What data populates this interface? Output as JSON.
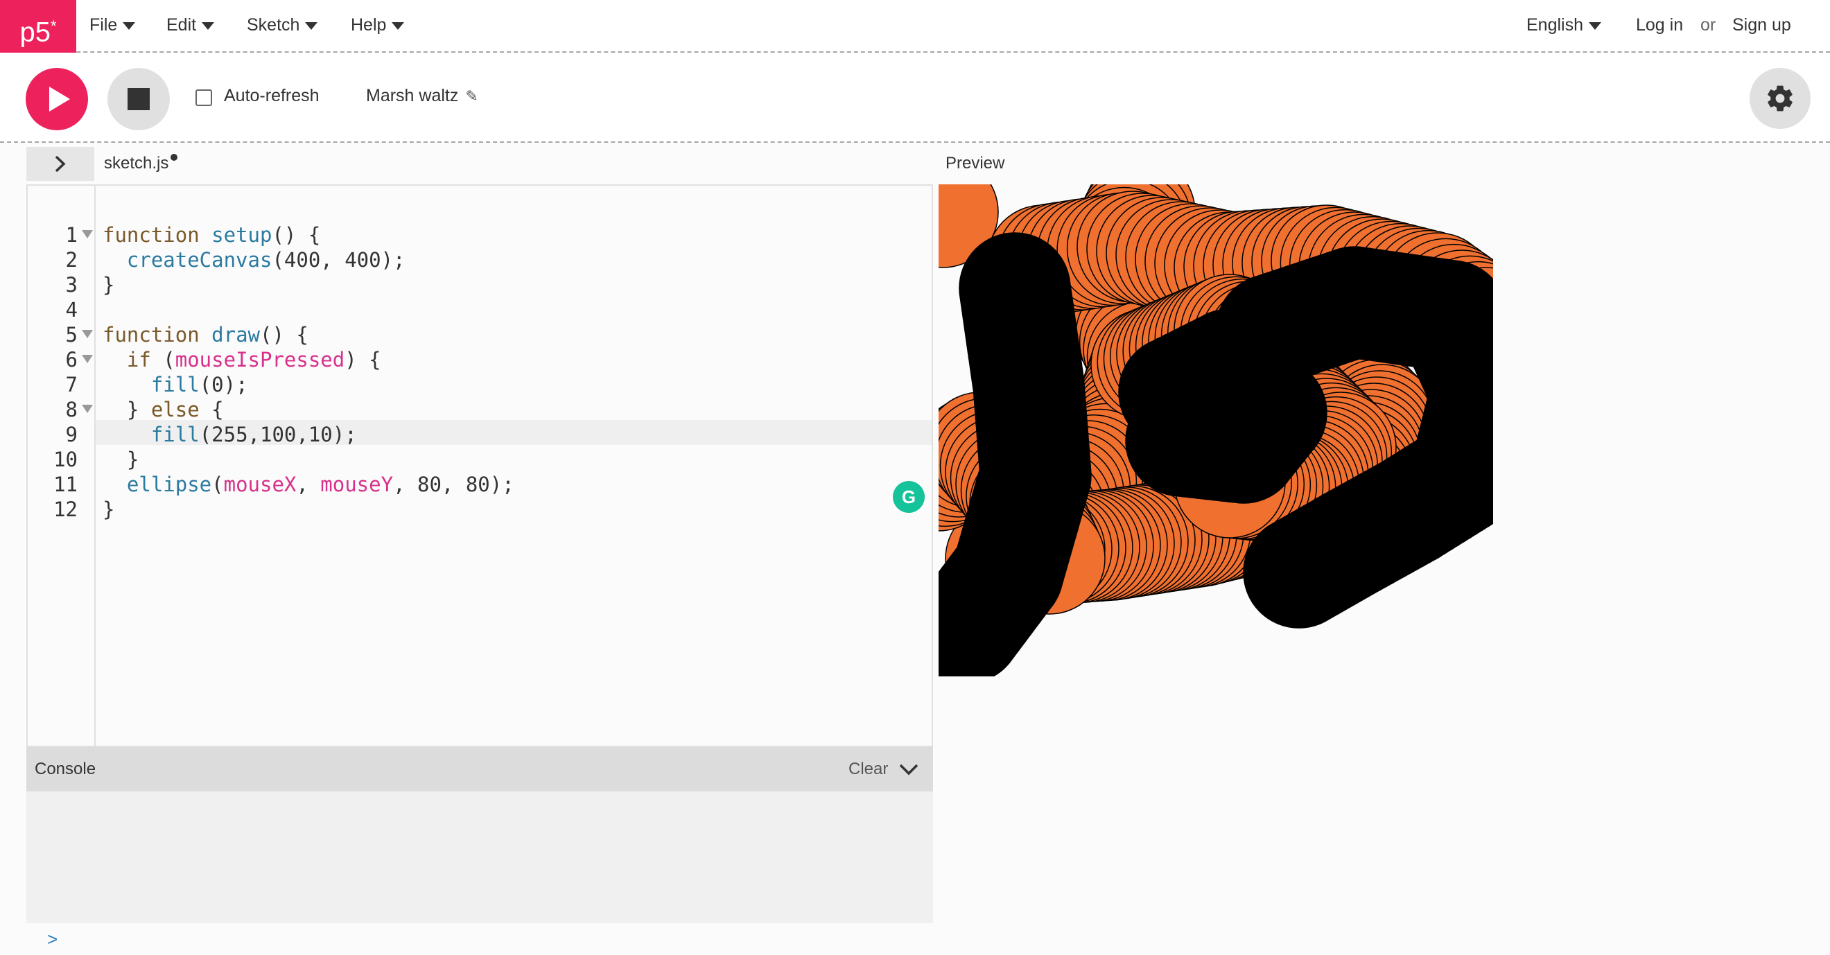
{
  "nav": {
    "logo": "p5",
    "logo_sup": "*",
    "menu": [
      {
        "label": "File"
      },
      {
        "label": "Edit"
      },
      {
        "label": "Sketch"
      },
      {
        "label": "Help"
      }
    ],
    "language": "English",
    "login": "Log in",
    "or": "or",
    "signup": "Sign up"
  },
  "toolbar": {
    "autorefresh_label": "Auto-refresh",
    "autorefresh_checked": false,
    "sketch_name": "Marsh waltz"
  },
  "editor": {
    "tab_name": "sketch.js",
    "active_line": 9,
    "line_numbers": [
      "1",
      "2",
      "3",
      "4",
      "5",
      "6",
      "7",
      "8",
      "9",
      "10",
      "11",
      "12"
    ],
    "folds": [
      1,
      5,
      6,
      8
    ]
  },
  "preview": {
    "label": "Preview",
    "fill_color": "#f07030",
    "stroke_color": "#000000"
  },
  "console": {
    "title": "Console",
    "clear_label": "Clear",
    "prompt": ">"
  },
  "colors": {
    "brand": "#ed225d",
    "keyword": "#7a5a2a",
    "function": "#2b7aa0",
    "variable": "#d9308b"
  },
  "icons": [
    "play-icon",
    "stop-icon",
    "pencil-icon",
    "gear-icon",
    "chevron-right-icon",
    "chevron-down-icon",
    "grammarly-icon"
  ]
}
